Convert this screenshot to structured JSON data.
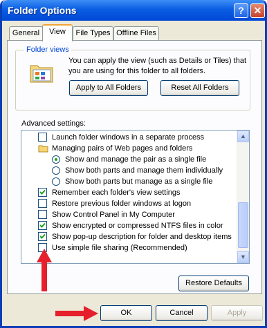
{
  "window": {
    "title": "Folder Options",
    "help_glyph": "?",
    "close_glyph": "✕"
  },
  "tabs": [
    "General",
    "View",
    "File Types",
    "Offline Files"
  ],
  "folder_views": {
    "legend": "Folder views",
    "description": "You can apply the view (such as Details or Tiles) that you are using for this folder to all folders.",
    "apply_label": "Apply to All Folders",
    "reset_label": "Reset All Folders"
  },
  "advanced": {
    "label": "Advanced settings:",
    "items": [
      {
        "label": "Launch folder windows in a separate process",
        "type": "checkbox",
        "checked": false
      },
      {
        "label": "Managing pairs of Web pages and folders",
        "type": "folder"
      },
      {
        "label": "Show and manage the pair as a single file",
        "type": "radio",
        "checked": true
      },
      {
        "label": "Show both parts and manage them individually",
        "type": "radio",
        "checked": false
      },
      {
        "label": "Show both parts but manage as a single file",
        "type": "radio",
        "checked": false
      },
      {
        "label": "Remember each folder's view settings",
        "type": "checkbox",
        "checked": true
      },
      {
        "label": "Restore previous folder windows at logon",
        "type": "checkbox",
        "checked": false
      },
      {
        "label": "Show Control Panel in My Computer",
        "type": "checkbox",
        "checked": false
      },
      {
        "label": "Show encrypted or compressed NTFS files in color",
        "type": "checkbox",
        "checked": true
      },
      {
        "label": "Show pop-up description for folder and desktop items",
        "type": "checkbox",
        "checked": true
      },
      {
        "label": "Use simple file sharing (Recommended)",
        "type": "checkbox",
        "checked": false
      }
    ],
    "restore_label": "Restore Defaults"
  },
  "footer": {
    "ok_label": "OK",
    "cancel_label": "Cancel",
    "apply_label": "Apply"
  },
  "colors": {
    "accent_blue": "#0A5EE2",
    "arrow_red": "#E61F2C",
    "check_green": "#21A121"
  }
}
